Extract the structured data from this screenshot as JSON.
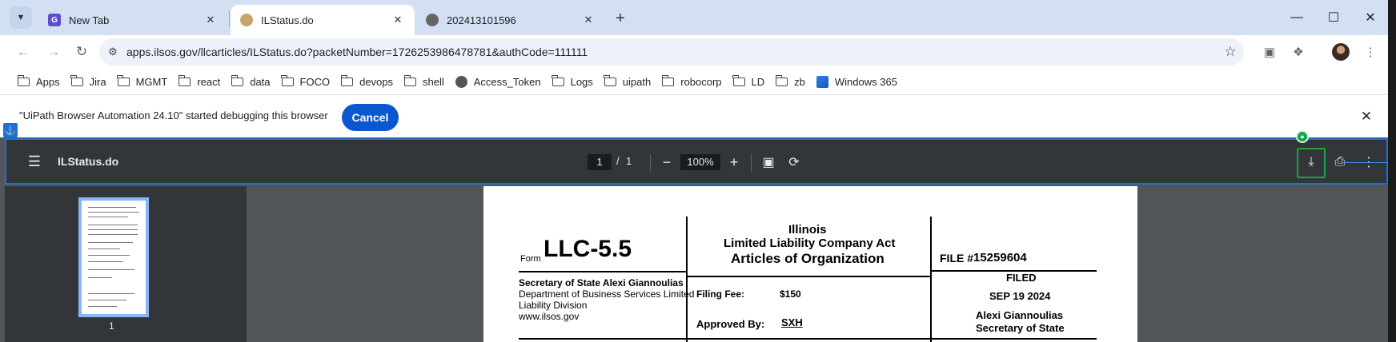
{
  "browser": {
    "tabs": [
      {
        "title": "New Tab",
        "favicon": "new-tab-icon"
      },
      {
        "title": "ILStatus.do",
        "favicon": "illinois-seal-icon",
        "active": true
      },
      {
        "title": "202413101596",
        "favicon": "globe-icon"
      }
    ],
    "address": {
      "url": "apps.ilsos.gov/llcarticles/ILStatus.do?packetNumber=1726253986478781&authCode=111111"
    },
    "bookmarks": [
      {
        "label": "Apps",
        "icon": "folder-icon"
      },
      {
        "label": "Jira",
        "icon": "folder-icon"
      },
      {
        "label": "MGMT",
        "icon": "folder-icon"
      },
      {
        "label": "react",
        "icon": "folder-icon"
      },
      {
        "label": "data",
        "icon": "folder-icon"
      },
      {
        "label": "FOCO",
        "icon": "folder-icon"
      },
      {
        "label": "devops",
        "icon": "folder-icon"
      },
      {
        "label": "shell",
        "icon": "folder-icon"
      },
      {
        "label": "Access_Token",
        "icon": "globe-icon"
      },
      {
        "label": "Logs",
        "icon": "folder-icon"
      },
      {
        "label": "uipath",
        "icon": "folder-icon"
      },
      {
        "label": "robocorp",
        "icon": "folder-icon"
      },
      {
        "label": "LD",
        "icon": "folder-icon"
      },
      {
        "label": "zb",
        "icon": "folder-icon"
      },
      {
        "label": "Windows 365",
        "icon": "windows365-icon"
      }
    ],
    "infobar": {
      "message": "\"UiPath Browser Automation 24.10\" started debugging this browser",
      "cancel_label": "Cancel"
    }
  },
  "pdf_viewer": {
    "title": "ILStatus.do",
    "page_current": "1",
    "page_separator": "/",
    "page_total": "1",
    "zoom": "100%",
    "thumbnail_label": "1"
  },
  "document": {
    "form_prefix": "Form",
    "form_number": "LLC-5.5",
    "state": "Illinois",
    "act": "Limited Liability Company Act",
    "doc_title": "Articles of Organization",
    "file_label": "FILE #",
    "file_number": "15259604",
    "sos_line": "Secretary of State Alexi Giannoulias",
    "dept_line1": "Department of Business Services Limited",
    "dept_line2": "Liability Division",
    "website": "www.ilsos.gov",
    "filing_fee_label": "Filing Fee:",
    "filing_fee_value": "$150",
    "approved_by_label": "Approved By:",
    "approved_by_value": "SXH",
    "filed_label": "FILED",
    "filed_date": "SEP 19 2024",
    "signer_name": "Alexi Giannoulias",
    "signer_title": "Secretary of State"
  },
  "colors": {
    "tabstrip": "#d3e0f3",
    "pdf_toolbar": "#323639",
    "pdf_background": "#525659",
    "cancel_button": "#0b57d0",
    "highlight_outline": "#1e6fd9",
    "download_outline": "#1aa34a"
  }
}
